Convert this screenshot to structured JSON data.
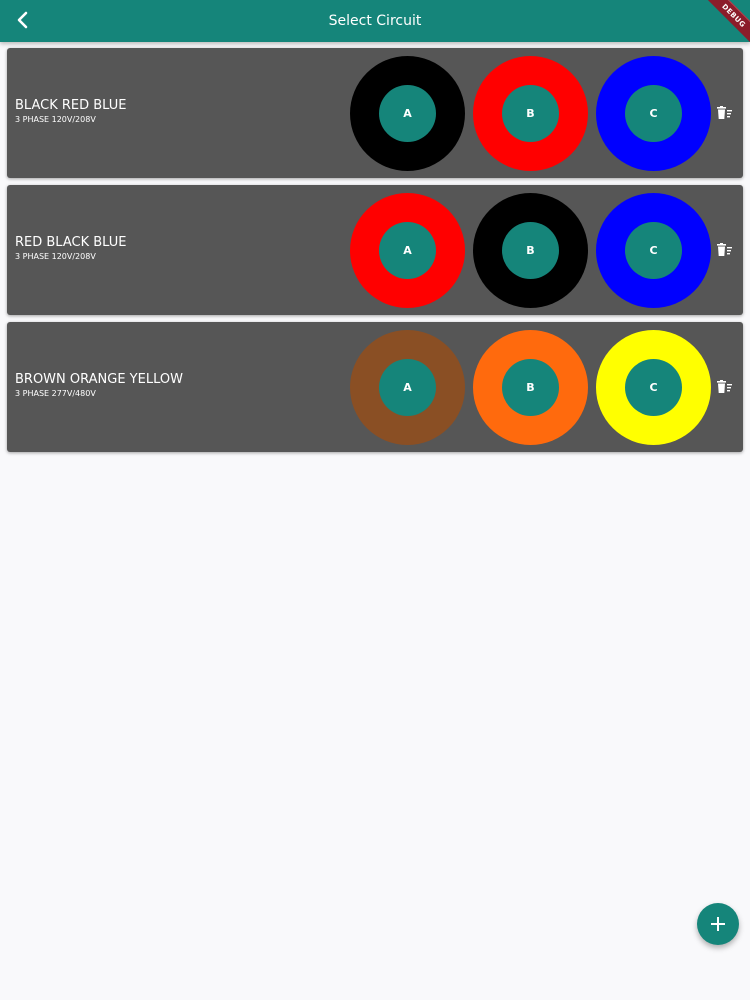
{
  "appbar": {
    "title": "Select Circuit",
    "debug_label": "DEBUG",
    "back_icon": "chevron-left-icon",
    "color": "#15857a"
  },
  "circuits": [
    {
      "name": "BLACK RED BLUE",
      "description": "3 PHASE 120V/208V",
      "phases": [
        {
          "label": "A",
          "color": "#000000"
        },
        {
          "label": "B",
          "color": "#ff0000"
        },
        {
          "label": "C",
          "color": "#0000ff"
        }
      ],
      "delete_icon": "delete-sweep-icon"
    },
    {
      "name": "RED BLACK BLUE",
      "description": "3 PHASE 120V/208V",
      "phases": [
        {
          "label": "A",
          "color": "#ff0000"
        },
        {
          "label": "B",
          "color": "#000000"
        },
        {
          "label": "C",
          "color": "#0000ff"
        }
      ],
      "delete_icon": "delete-sweep-icon"
    },
    {
      "name": "BROWN ORANGE YELLOW",
      "description": "3 PHASE 277V/480V",
      "phases": [
        {
          "label": "A",
          "color": "#8a4f24"
        },
        {
          "label": "B",
          "color": "#ff6a0d"
        },
        {
          "label": "C",
          "color": "#ffff00"
        }
      ],
      "delete_icon": "delete-sweep-icon"
    }
  ],
  "fab": {
    "icon": "plus-icon"
  }
}
